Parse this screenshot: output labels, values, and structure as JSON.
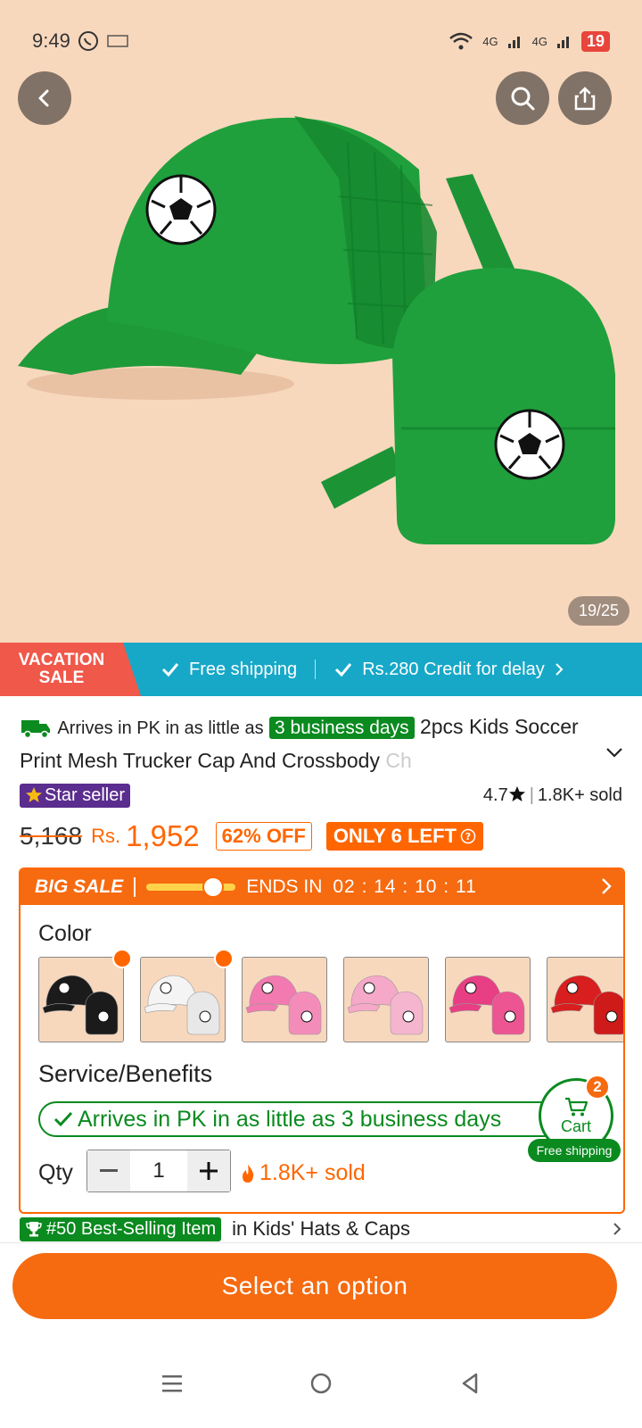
{
  "status_bar": {
    "time": "9:49",
    "battery": "19",
    "network_1": "4G",
    "network_2": "4G"
  },
  "image_counter": "19/25",
  "banner": {
    "vacation_line1": "VACATION",
    "vacation_line2": "SALE",
    "item1": "Free shipping",
    "item2": "Rs.280 Credit for delay"
  },
  "title": {
    "arrives_prefix": "Arrives in PK in as little as",
    "days_badge": "3 business days",
    "product_name": "2pcs Kids Soccer Print Mesh Trucker Cap And Crossbody",
    "product_name_fade": "Ch"
  },
  "seller": {
    "badge": "Star seller",
    "rating": "4.7",
    "sold": "1.8K+ sold"
  },
  "price": {
    "old": "5,168",
    "currency": "Rs.",
    "new": "1,952",
    "off": "62% OFF",
    "left": "ONLY 6 LEFT"
  },
  "sale": {
    "label": "BIG SALE",
    "ends_label": "ENDS IN",
    "timer": "02 : 14 : 10 : 11",
    "progress": 0.75
  },
  "color": {
    "label": "Color",
    "swatches": [
      {
        "name": "black",
        "cap": "#1b1b1b",
        "bag": "#1b1b1b",
        "hot": true
      },
      {
        "name": "white",
        "cap": "#f4f4f4",
        "bag": "#e8e8e8",
        "hot": true
      },
      {
        "name": "pink",
        "cap": "#f27ab0",
        "bag": "#f48cba",
        "hot": false
      },
      {
        "name": "light-pink",
        "cap": "#f5a8c8",
        "bag": "#f5b5cf",
        "hot": false
      },
      {
        "name": "rose",
        "cap": "#e83e84",
        "bag": "#ec5591",
        "hot": false
      },
      {
        "name": "red",
        "cap": "#d81e1e",
        "bag": "#cf1a1a",
        "hot": false
      }
    ]
  },
  "service": {
    "label": "Service/Benefits",
    "pill": "Arrives in PK in as little as 3 business days"
  },
  "qty": {
    "label": "Qty",
    "value": "1",
    "sold": "1.8K+ sold"
  },
  "cart": {
    "label": "Cart",
    "count": "2",
    "free": "Free shipping"
  },
  "best": {
    "badge": "#50 Best-Selling Item",
    "category": "in Kids' Hats & Caps"
  },
  "cta": {
    "label": "Select an option"
  },
  "colors": {
    "accent": "#f66a10",
    "green": "#0a8a1f",
    "banner": "#17a8c8",
    "hero_bg": "#f8d8bd"
  }
}
